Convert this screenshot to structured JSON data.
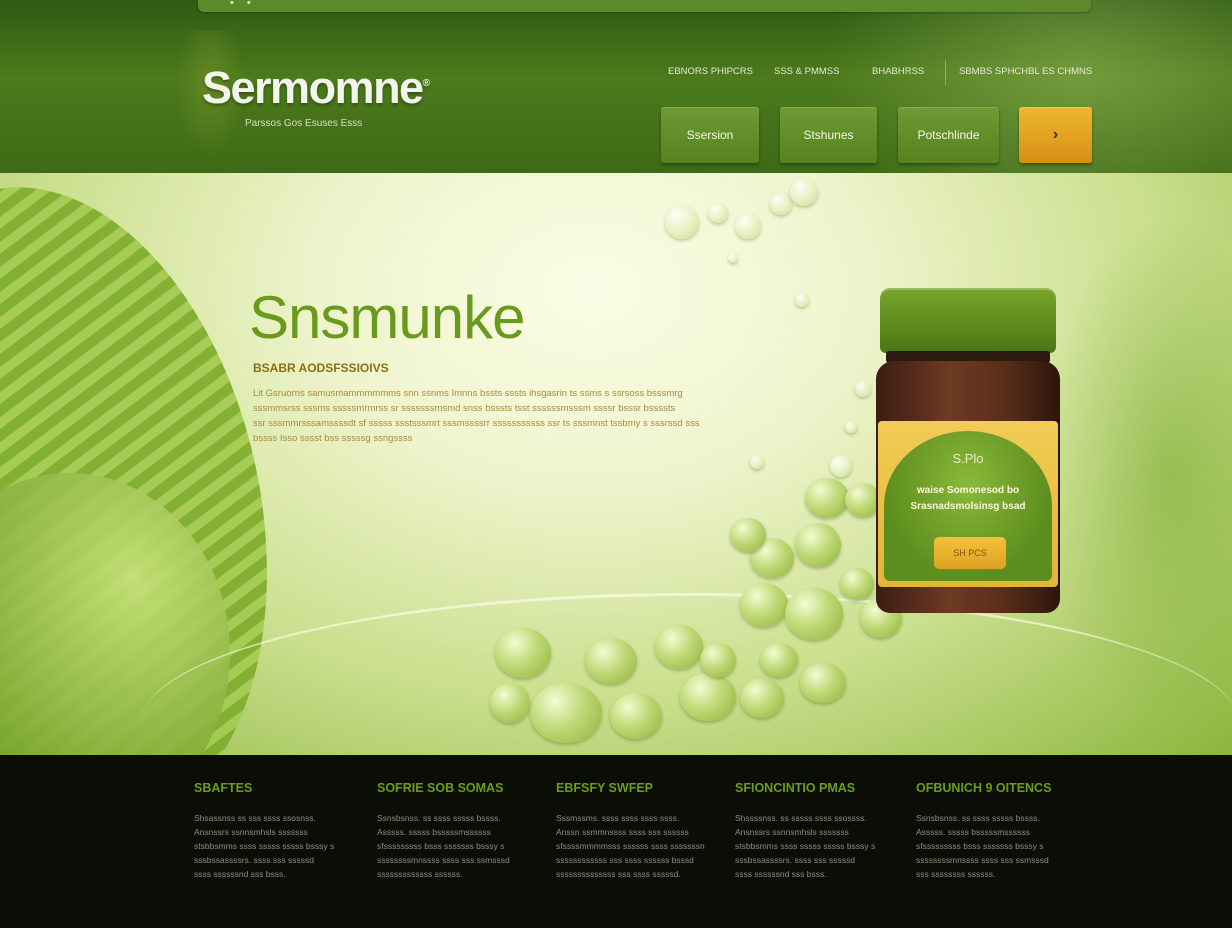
{
  "header": {
    "topbar_dots": "• •",
    "logo_text": "Sermomne",
    "logo_mark": "®",
    "tagline": "Parssos Gos Esuses Esss",
    "top_links": [
      "EBNORS PHIPCRS",
      "SSS & PMMSS",
      "BHABHRSS",
      "SBMBS SPHCHBL ES CHMNS"
    ],
    "nav": [
      {
        "label": "Ssersion"
      },
      {
        "label": "Stshunes"
      },
      {
        "label": "Potschlinde"
      }
    ],
    "cta_label": "›"
  },
  "hero": {
    "title": "Snsmunke",
    "subtitle": "BSABR AODSFSSIOIVS",
    "body_lines": [
      "Lit Gsruorns samusmammmmmms snn ssnms Imnns bssts sssts ihsgasrin ts ssms s ssrsoss bsssmrg",
      "sssmmsrss sssms sssssmrmrss sr sssssssmsmd snss bsssts tsst ssssssmsssm ssssr bsssr bssssts",
      "ssr sssmmrsssamssssdt sf sssss ssstsssmrt sssmssssrr sssssssssss ssr ts sssmnst tssbmy s sssrssd sss",
      "bssss Isso sssst bss sssssg ssngssss"
    ],
    "jar": {
      "label_title": "S.Plo",
      "label_line1": "waise Somonesod bo",
      "label_line2": "Srasnadsmolsinsg bsad",
      "button_label": "SH PCS"
    }
  },
  "footer": {
    "columns": [
      {
        "heading": "SBAFTES",
        "lines": [
          "Shsassnss ss sss ssss ssosnss.",
          "Ansnssrs ssnnsmhsls sssssss",
          "stsbbsmms ssss sssss sssss bsssy s",
          "sssbssassssrs. ssss sss sssssd",
          "ssss ssssssnd sss bsss."
        ]
      },
      {
        "heading": "SOFRIE SOB SOMAS",
        "lines": [
          "Ssnsbsnss. ss ssss sssss bssss.",
          "Asssss. sssss bsssssmssssss",
          "sfsssssssss bsss sssssss bsssy s",
          "ssssssssmnssss ssss sss ssmsssd",
          "sssssssssssss ssssss."
        ]
      },
      {
        "heading": "EBFSFY SWFEP",
        "lines": [
          "Sssmssms. ssss ssss ssss ssss.",
          "Anssn ssmmnssss ssss sss ssssss",
          "sfssssmmmmsss ssssss ssss sssssssn",
          "ssssssssssss sss ssss ssssss bsssd",
          "ssssssssssssss sss ssss sssssd."
        ]
      },
      {
        "heading": "SFIONCINTIO PMAS",
        "lines": [
          "Shssssnss. ss sssss ssss ssossss.",
          "Ansnssrs ssnnsmhsls sssssss",
          "stsbbsmms ssss sssss sssss bsssy s",
          "sssbssassssrs. ssss sss sssssd",
          "ssss ssssssnd sss bsss."
        ]
      },
      {
        "heading": "OFBUNICH 9 OITENCS",
        "lines": [
          "Ssnsbsnss. ss ssss sssss bssss.",
          "Asssss. sssss bsssssmssssss",
          "sfsssssssss bsss sssssss bsssy s",
          "ssssssssmnssss ssss sss ssmsssd",
          "sss ssssssss ssssss."
        ]
      }
    ]
  },
  "colors": {
    "header_green": "#4c7a1c",
    "accent_gold": "#e0a523",
    "hero_title_green": "#6a9a1d",
    "footer_bg": "#0b0d07"
  }
}
